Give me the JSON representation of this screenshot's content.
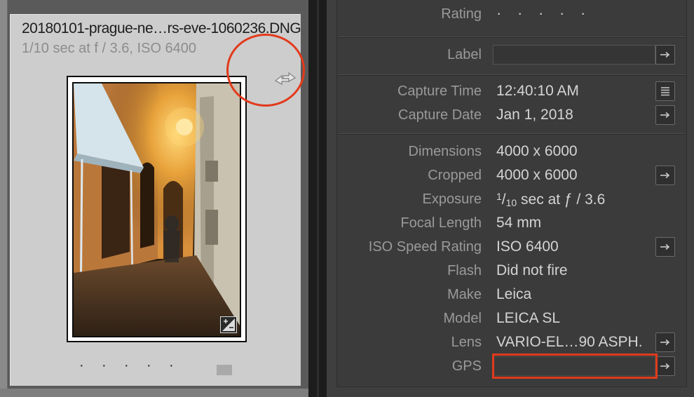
{
  "thumbnail": {
    "file_name": "20180101-prague-ne…rs-eve-1060236.DNG",
    "exposure_summary": "1/10 sec at f / 3.6, ISO 6400",
    "rating_dots": [
      "·",
      "·",
      "·",
      "·",
      "·"
    ]
  },
  "metadata": {
    "rating": {
      "label": "Rating",
      "dots": [
        "·",
        "·",
        "·",
        "·",
        "·"
      ]
    },
    "label": {
      "label": "Label"
    },
    "capture_time": {
      "label": "Capture Time",
      "value": "12:40:10 AM"
    },
    "capture_date": {
      "label": "Capture Date",
      "value": "Jan 1, 2018"
    },
    "dimensions": {
      "label": "Dimensions",
      "value": "4000 x 6000"
    },
    "cropped": {
      "label": "Cropped",
      "value": "4000 x 6000"
    },
    "exposure": {
      "label": "Exposure",
      "num": "1",
      "den": "10",
      "rest": " sec at ƒ / 3.6"
    },
    "focal_length": {
      "label": "Focal Length",
      "value": "54 mm"
    },
    "iso": {
      "label": "ISO Speed Rating",
      "value": "ISO 6400"
    },
    "flash": {
      "label": "Flash",
      "value": "Did not fire"
    },
    "make": {
      "label": "Make",
      "value": "Leica"
    },
    "model": {
      "label": "Model",
      "value": "LEICA SL"
    },
    "lens": {
      "label": "Lens",
      "value": "VARIO-EL…90 ASPH."
    },
    "gps": {
      "label": "GPS",
      "value": ""
    }
  },
  "icons": {
    "rotate": "rotate-arrows-icon",
    "arrow": "arrow-right-icon",
    "list": "list-icon",
    "edit_badge": "exposure-badge-icon"
  },
  "colors": {
    "annotation": "#e23a1c",
    "panel_bg": "#3b3b3b",
    "cell_bg": "#cdcdcd"
  }
}
